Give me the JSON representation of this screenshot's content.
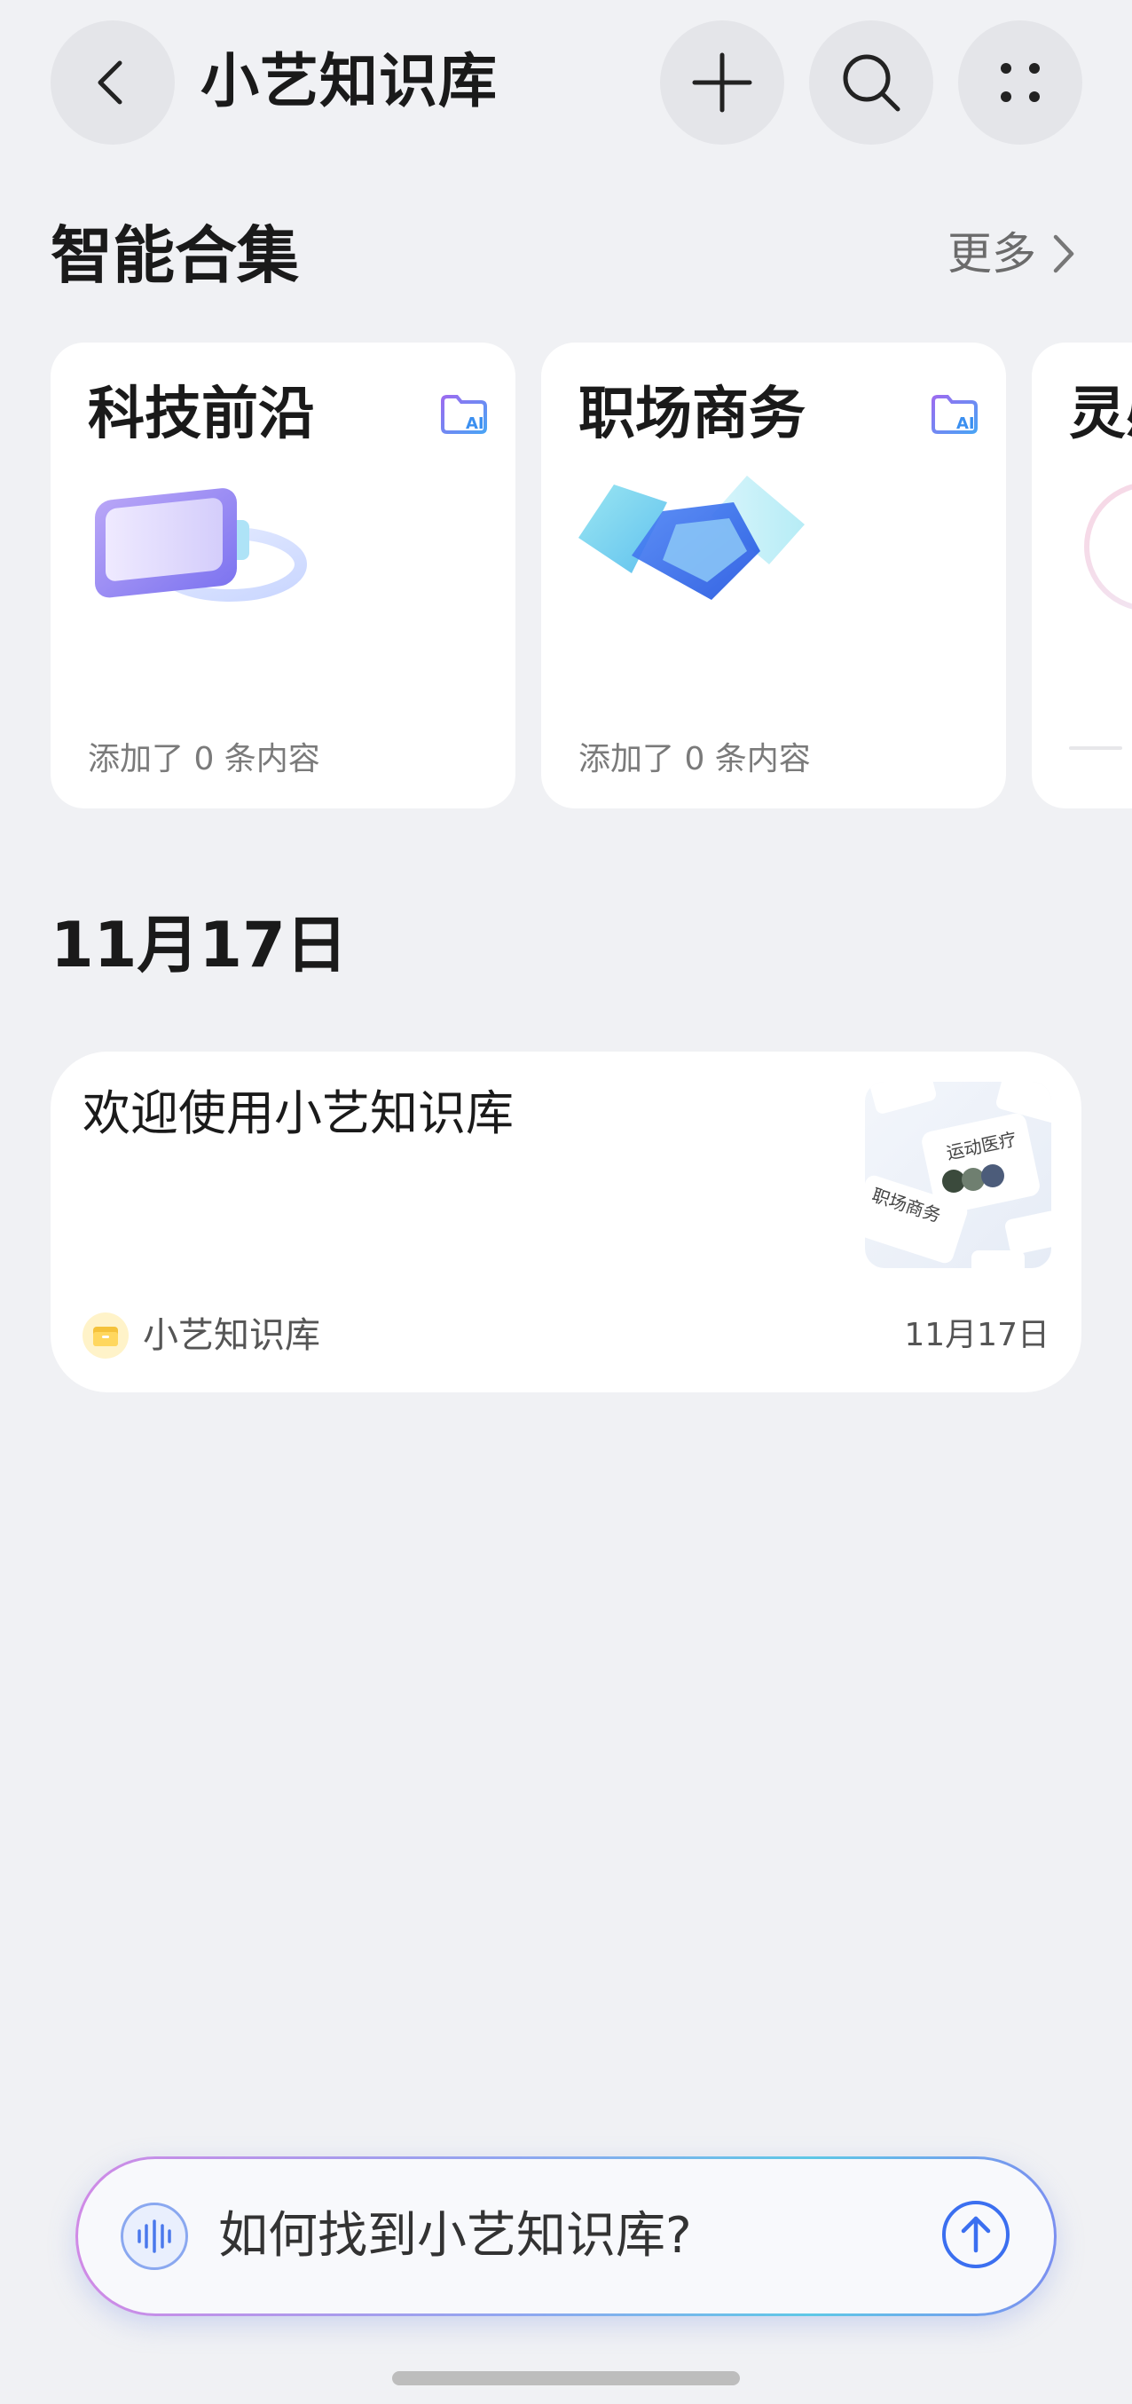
{
  "header": {
    "title": "小艺知识库",
    "back_icon": "chevron-left-icon",
    "add_icon": "plus-icon",
    "search_icon": "search-icon",
    "menu_icon": "grid-dots-icon"
  },
  "smart_collections": {
    "title": "智能合集",
    "more_label": "更多",
    "cards": [
      {
        "title": "科技前沿",
        "count": "添加了 0 条内容",
        "icon": "vr-headset-icon"
      },
      {
        "title": "职场商务",
        "count": "添加了 0 条内容",
        "icon": "handshake-icon"
      },
      {
        "title": "灵感",
        "count": "",
        "icon": "circle-icon"
      }
    ]
  },
  "timeline": {
    "date": "11月17日",
    "items": [
      {
        "title": "欢迎使用小艺知识库",
        "source": "小艺知识库",
        "date": "11月17日",
        "thumb_texts": [
          "运动医疗",
          "职场商务"
        ]
      }
    ]
  },
  "ask_bar": {
    "placeholder": "如何找到小艺知识库?"
  },
  "colors": {
    "background": "#f0f1f4",
    "card": "#ffffff",
    "accent_blue": "#3b6ff0"
  }
}
